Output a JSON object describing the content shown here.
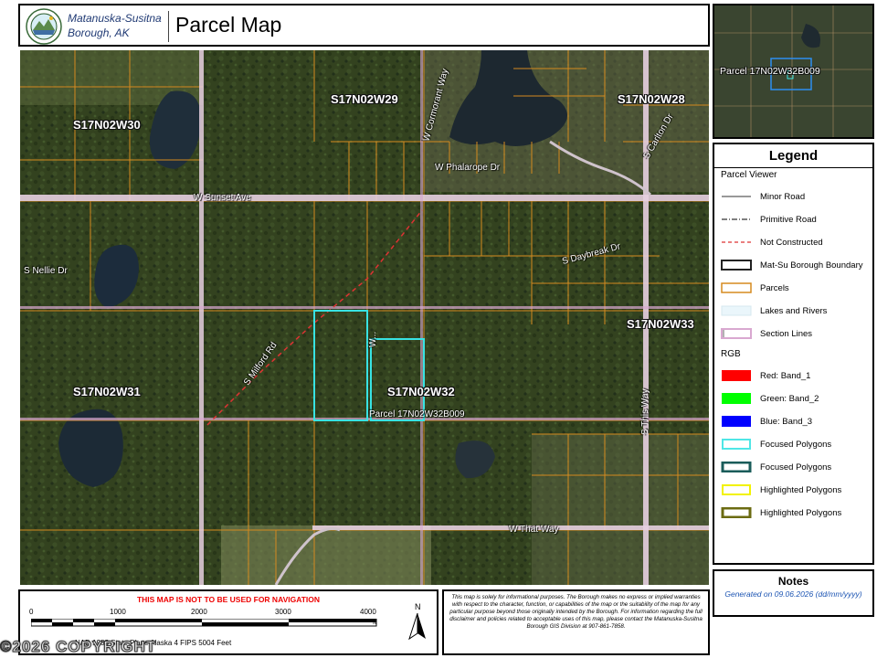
{
  "header": {
    "org_line1": "Matanuska-Susitna",
    "org_line2": "Borough, AK",
    "title": "Parcel Map"
  },
  "map": {
    "sections": [
      "S17N02W30",
      "S17N02W29",
      "S17N02W28",
      "S17N02W31",
      "S17N02W32",
      "S17N02W33"
    ],
    "roads": [
      "W Sunset Ave",
      "W Phalarope Dr",
      "S Carlton Dr",
      "S Nellie Dr",
      "S Daybreak Dr",
      "S Milford Rd",
      "S This Way",
      "W That Way",
      "W Cormorant Way",
      "W..."
    ],
    "focused_parcel_label": "Parcel 17N02W32B009"
  },
  "inset": {
    "label": "Parcel 17N02W32B009"
  },
  "legend": {
    "title": "Legend",
    "group1": "Parcel Viewer",
    "items": [
      {
        "label": "Minor Road",
        "icon": "minor-road"
      },
      {
        "label": "Primitive Road",
        "icon": "primitive-road"
      },
      {
        "label": "Not Constructed",
        "icon": "not-constructed"
      },
      {
        "label": "Mat-Su Borough Boundary",
        "icon": "borough-boundary"
      },
      {
        "label": "Parcels",
        "icon": "parcels"
      },
      {
        "label": "Lakes and Rivers",
        "icon": "lakes"
      },
      {
        "label": "Section Lines",
        "icon": "section-lines"
      }
    ],
    "group2": "RGB",
    "items2": [
      {
        "label": "Red:  Band_1",
        "color": "#ff0000"
      },
      {
        "label": "Green: Band_2",
        "color": "#00ff00"
      },
      {
        "label": "Blue:  Band_3",
        "color": "#0000ff"
      },
      {
        "label": "Focused Polygons",
        "color": "#4fe6e6"
      },
      {
        "label": "Focused Polygons",
        "color": "#1a5c5a"
      },
      {
        "label": "Highlighted Polygons",
        "color": "#f2f200"
      },
      {
        "label": "Highlighted Polygons",
        "color": "#6b6b12"
      }
    ]
  },
  "notes": {
    "title": "Notes",
    "generated_prefix": "Generated on",
    "date": "09.06.2026",
    "format": "(dd/mm/yyyy)"
  },
  "scale": {
    "warning": "THIS MAP IS NOT TO BE USED FOR NAVIGATION",
    "ticks": [
      "0",
      "1000",
      "2000",
      "3000",
      "4000"
    ],
    "unit": "ft",
    "north": "N",
    "projection": "NAD 1983 State Plane Alaska 4 FIPS 5004 Feet"
  },
  "disclaimer": "This map is solely for informational purposes. The Borough makes no express or implied warranties with respect to the character, function, or capabilities of the map or the suitability of the map for any particular purpose beyond those originally intended by the Borough. For information regarding the full disclaimer and policies related to acceptable uses of this map, please contact the Matanuska-Susitna Borough GIS Division at 907-861-7858.",
  "copyright": "©2026 COPYRIGHT"
}
